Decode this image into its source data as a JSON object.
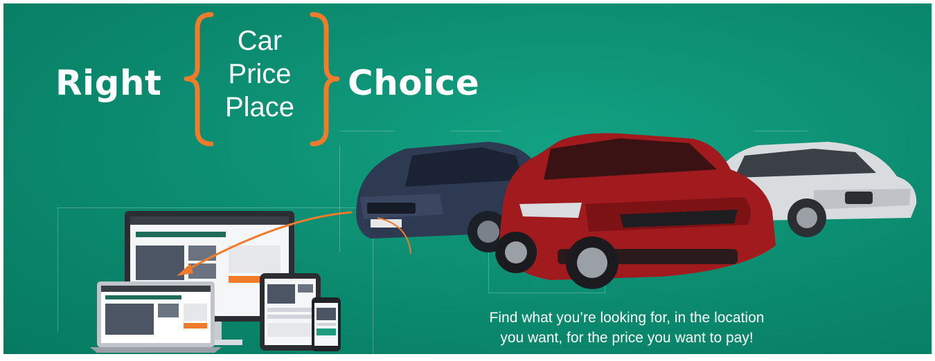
{
  "headline": {
    "left_word": "Right",
    "right_word": "Choice",
    "options": [
      "Car",
      "Price",
      "Place"
    ]
  },
  "tagline": {
    "line1": "Find what you’re looking for, in the location",
    "line2": "you want, for the price you want to pay!"
  },
  "colors": {
    "background": "#0b8a6e",
    "accent": "#f07b2a",
    "text": "#ffffff"
  },
  "icons": [
    "left-brace-icon",
    "right-brace-icon",
    "curved-arrow-icon"
  ]
}
